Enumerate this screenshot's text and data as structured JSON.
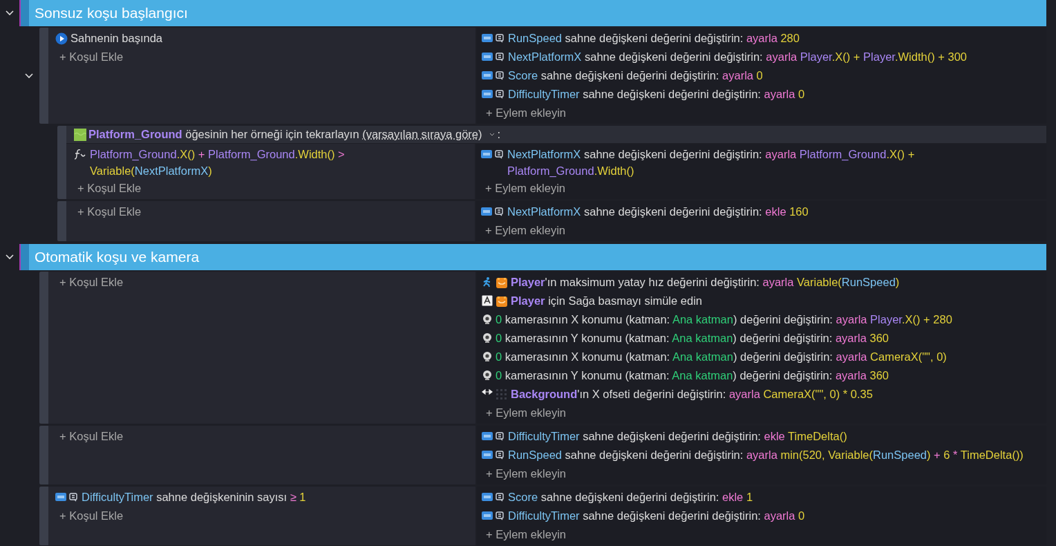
{
  "groups": [
    {
      "title": "Sonsuz koşu başlangıcı",
      "expanded": true,
      "events": [
        {
          "expanded": true,
          "add_condition": "+ Koşul Ekle",
          "add_action": "+ Eylem ekleyin",
          "conditions": [
            {
              "icons": [
                {
                  "kind": "scene-start"
                }
              ],
              "parts": [
                {
                  "text": "Sahnenin başında",
                  "kind": "text"
                }
              ]
            }
          ],
          "actions": [
            {
              "icons": [
                {
                  "kind": "variable"
                }
              ],
              "parts": [
                {
                  "text": "RunSpeed",
                  "kind": "var"
                },
                {
                  "text": " sahne değişkeni değerini değiştirin: ",
                  "kind": "text"
                },
                {
                  "text": "ayarla ",
                  "kind": "op"
                },
                {
                  "text": "280",
                  "kind": "num"
                }
              ]
            },
            {
              "icons": [
                {
                  "kind": "variable"
                }
              ],
              "parts": [
                {
                  "text": "NextPlatformX",
                  "kind": "var"
                },
                {
                  "text": " sahne değişkeni değerini değiştirin: ",
                  "kind": "text"
                },
                {
                  "text": "ayarla ",
                  "kind": "op"
                },
                {
                  "text": "Player",
                  "kind": "obj"
                },
                {
                  "text": ".X() + ",
                  "kind": "fn"
                },
                {
                  "text": "Player",
                  "kind": "obj"
                },
                {
                  "text": ".Width() + 300",
                  "kind": "fn"
                }
              ]
            },
            {
              "icons": [
                {
                  "kind": "variable"
                }
              ],
              "parts": [
                {
                  "text": "Score",
                  "kind": "var"
                },
                {
                  "text": " sahne değişkeni değerini değiştirin: ",
                  "kind": "text"
                },
                {
                  "text": "ayarla ",
                  "kind": "op"
                },
                {
                  "text": "0",
                  "kind": "num"
                }
              ]
            },
            {
              "icons": [
                {
                  "kind": "variable"
                }
              ],
              "parts": [
                {
                  "text": "DifficultyTimer",
                  "kind": "var"
                },
                {
                  "text": " sahne değişkeni değerini değiştirin: ",
                  "kind": "text"
                },
                {
                  "text": "ayarla ",
                  "kind": "op"
                },
                {
                  "text": "0",
                  "kind": "num"
                }
              ]
            }
          ],
          "children": [
            {
              "kind": "for-each",
              "add_condition": "+ Koşul Ekle",
              "add_action": "+ Eylem ekleyin",
              "header": {
                "icons": [
                  {
                    "kind": "ground-sprite"
                  }
                ],
                "parts": [
                  {
                    "text": "Platform_Ground",
                    "kind": "object"
                  },
                  {
                    "text": " öğesinin her örneği için tekrarlayın ",
                    "kind": "text"
                  },
                  {
                    "text": "(varsayılan sıraya göre)",
                    "kind": "link"
                  }
                ],
                "suffix": ":"
              },
              "conditions": [
                {
                  "icons": [
                    {
                      "kind": "expression"
                    }
                  ],
                  "parts": [
                    {
                      "text": "Platform_Ground",
                      "kind": "obj"
                    },
                    {
                      "text": ".X()",
                      "kind": "fn"
                    },
                    {
                      "text": " + ",
                      "kind": "op"
                    },
                    {
                      "text": "Platform_Ground",
                      "kind": "obj"
                    },
                    {
                      "text": ".Width()",
                      "kind": "fn"
                    },
                    {
                      "text": " > ",
                      "kind": "op"
                    },
                    {
                      "text": "Variable(",
                      "kind": "fn"
                    },
                    {
                      "text": "NextPlatformX",
                      "kind": "var"
                    },
                    {
                      "text": ")",
                      "kind": "fn"
                    }
                  ]
                }
              ],
              "actions": [
                {
                  "icons": [
                    {
                      "kind": "variable"
                    }
                  ],
                  "parts": [
                    {
                      "text": "NextPlatformX",
                      "kind": "var"
                    },
                    {
                      "text": " sahne değişkeni değerini değiştirin: ",
                      "kind": "text"
                    },
                    {
                      "text": "ayarla ",
                      "kind": "op"
                    },
                    {
                      "text": "Platform_Ground",
                      "kind": "obj"
                    },
                    {
                      "text": ".X() + ",
                      "kind": "fn"
                    },
                    {
                      "text": "Platform_Ground",
                      "kind": "obj"
                    },
                    {
                      "text": ".Width()",
                      "kind": "fn"
                    }
                  ]
                }
              ]
            },
            {
              "kind": "standard",
              "add_condition": "+ Koşul Ekle",
              "add_action": "+ Eylem ekleyin",
              "actions": [
                {
                  "icons": [
                    {
                      "kind": "variable"
                    }
                  ],
                  "parts": [
                    {
                      "text": "NextPlatformX",
                      "kind": "var"
                    },
                    {
                      "text": " sahne değişkeni değerini değiştirin: ",
                      "kind": "text"
                    },
                    {
                      "text": "ekle ",
                      "kind": "op"
                    },
                    {
                      "text": "160",
                      "kind": "num"
                    }
                  ]
                }
              ]
            }
          ]
        }
      ]
    },
    {
      "title": "Otomatik koşu ve kamera",
      "expanded": true,
      "events": [
        {
          "add_condition": "+ Koşul Ekle",
          "add_action": "+ Eylem ekleyin",
          "actions": [
            {
              "icons": [
                {
                  "kind": "platformer"
                },
                {
                  "kind": "player-sprite"
                }
              ],
              "parts": [
                {
                  "text": "Player",
                  "kind": "object"
                },
                {
                  "text": "'ın maksimum yatay hız değerini değiştirin: ",
                  "kind": "text"
                },
                {
                  "text": "ayarla ",
                  "kind": "op"
                },
                {
                  "text": "Variable(",
                  "kind": "fn"
                },
                {
                  "text": "RunSpeed",
                  "kind": "var"
                },
                {
                  "text": ")",
                  "kind": "fn"
                }
              ]
            },
            {
              "icons": [
                {
                  "kind": "key"
                },
                {
                  "kind": "player-sprite"
                }
              ],
              "parts": [
                {
                  "text": "Player",
                  "kind": "object"
                },
                {
                  "text": " için Sağa basmayı simüle edin",
                  "kind": "text"
                }
              ]
            },
            {
              "icons": [
                {
                  "kind": "camera"
                }
              ],
              "parts": [
                {
                  "text": "0",
                  "kind": "layer"
                },
                {
                  "text": " kamerasının X konumu (katman: ",
                  "kind": "text"
                },
                {
                  "text": "Ana katman",
                  "kind": "layer"
                },
                {
                  "text": ") değerini değiştirin: ",
                  "kind": "text"
                },
                {
                  "text": "ayarla ",
                  "kind": "op"
                },
                {
                  "text": "Player",
                  "kind": "obj"
                },
                {
                  "text": ".X() + 280",
                  "kind": "fn"
                }
              ]
            },
            {
              "icons": [
                {
                  "kind": "camera"
                }
              ],
              "parts": [
                {
                  "text": "0",
                  "kind": "layer"
                },
                {
                  "text": " kamerasının Y konumu (katman: ",
                  "kind": "text"
                },
                {
                  "text": "Ana katman",
                  "kind": "layer"
                },
                {
                  "text": ") değerini değiştirin: ",
                  "kind": "text"
                },
                {
                  "text": "ayarla ",
                  "kind": "op"
                },
                {
                  "text": "360",
                  "kind": "num"
                }
              ]
            },
            {
              "icons": [
                {
                  "kind": "camera"
                }
              ],
              "parts": [
                {
                  "text": "0",
                  "kind": "layer"
                },
                {
                  "text": " kamerasının X konumu (katman: ",
                  "kind": "text"
                },
                {
                  "text": "Ana katman",
                  "kind": "layer"
                },
                {
                  "text": ") değerini değiştirin: ",
                  "kind": "text"
                },
                {
                  "text": "ayarla ",
                  "kind": "op"
                },
                {
                  "text": "CameraX(\"\", 0)",
                  "kind": "fn"
                }
              ]
            },
            {
              "icons": [
                {
                  "kind": "camera"
                }
              ],
              "parts": [
                {
                  "text": "0",
                  "kind": "layer"
                },
                {
                  "text": " kamerasının Y konumu (katman: ",
                  "kind": "text"
                },
                {
                  "text": "Ana katman",
                  "kind": "layer"
                },
                {
                  "text": ") değerini değiştirin: ",
                  "kind": "text"
                },
                {
                  "text": "ayarla ",
                  "kind": "op"
                },
                {
                  "text": "360",
                  "kind": "num"
                }
              ]
            },
            {
              "icons": [
                {
                  "kind": "parallax"
                },
                {
                  "kind": "background-sprite"
                }
              ],
              "parts": [
                {
                  "text": "Background",
                  "kind": "object"
                },
                {
                  "text": "'ın X ofseti değerini değiştirin: ",
                  "kind": "text"
                },
                {
                  "text": "ayarla ",
                  "kind": "op"
                },
                {
                  "text": "CameraX(\"\", 0) * 0.35",
                  "kind": "fn"
                }
              ]
            }
          ]
        },
        {
          "add_condition": "+ Koşul Ekle",
          "add_action": "+ Eylem ekleyin",
          "actions": [
            {
              "icons": [
                {
                  "kind": "variable"
                }
              ],
              "parts": [
                {
                  "text": "DifficultyTimer",
                  "kind": "var"
                },
                {
                  "text": " sahne değişkeni değerini değiştirin: ",
                  "kind": "text"
                },
                {
                  "text": "ekle ",
                  "kind": "op"
                },
                {
                  "text": "TimeDelta()",
                  "kind": "fn"
                }
              ]
            },
            {
              "icons": [
                {
                  "kind": "variable"
                }
              ],
              "parts": [
                {
                  "text": "RunSpeed",
                  "kind": "var"
                },
                {
                  "text": " sahne değişkeni değerini değiştirin: ",
                  "kind": "text"
                },
                {
                  "text": "ayarla ",
                  "kind": "op"
                },
                {
                  "text": "min(520, Variable(",
                  "kind": "fn"
                },
                {
                  "text": "RunSpeed",
                  "kind": "var"
                },
                {
                  "text": ")",
                  "kind": "fn"
                },
                {
                  "text": " + ",
                  "kind": "op"
                },
                {
                  "text": "6 ",
                  "kind": "num"
                },
                {
                  "text": "* ",
                  "kind": "op"
                },
                {
                  "text": "TimeDelta())",
                  "kind": "fn"
                }
              ]
            }
          ]
        },
        {
          "add_condition": "+ Koşul Ekle",
          "add_action": "+ Eylem ekleyin",
          "conditions": [
            {
              "icons": [
                {
                  "kind": "variable"
                }
              ],
              "parts": [
                {
                  "text": "DifficultyTimer",
                  "kind": "var"
                },
                {
                  "text": " sahne değişkeninin sayısı ",
                  "kind": "text"
                },
                {
                  "text": "≥ ",
                  "kind": "op"
                },
                {
                  "text": "1",
                  "kind": "num"
                }
              ]
            }
          ],
          "actions": [
            {
              "icons": [
                {
                  "kind": "variable"
                }
              ],
              "parts": [
                {
                  "text": "Score",
                  "kind": "var"
                },
                {
                  "text": " sahne değişkeni değerini değiştirin: ",
                  "kind": "text"
                },
                {
                  "text": "ekle ",
                  "kind": "op"
                },
                {
                  "text": "1",
                  "kind": "num"
                }
              ]
            },
            {
              "icons": [
                {
                  "kind": "variable"
                }
              ],
              "parts": [
                {
                  "text": "DifficultyTimer",
                  "kind": "var"
                },
                {
                  "text": " sahne değişkeni değerini değiştirin: ",
                  "kind": "text"
                },
                {
                  "text": "ayarla ",
                  "kind": "op"
                },
                {
                  "text": "0",
                  "kind": "num"
                }
              ]
            }
          ]
        }
      ]
    }
  ]
}
